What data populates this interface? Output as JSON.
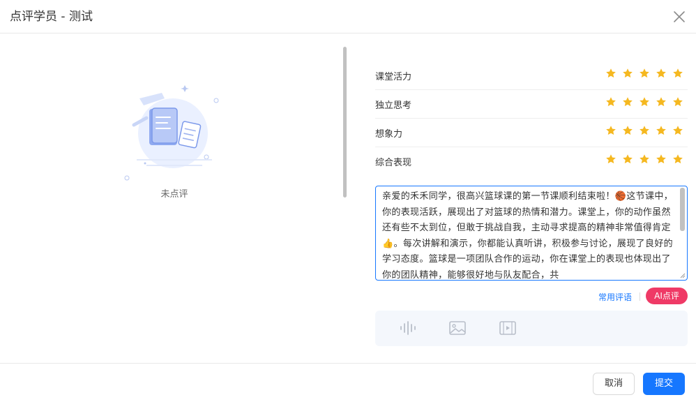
{
  "dialog": {
    "title": "点评学员 - 测试",
    "close_icon": "close-icon"
  },
  "left": {
    "empty_label": "未点评",
    "illustration_icon": "empty-document-illustration"
  },
  "ratings": {
    "max_stars": 5,
    "items": [
      {
        "label": "课堂活力",
        "score": 5
      },
      {
        "label": "独立思考",
        "score": 5
      },
      {
        "label": "想象力",
        "score": 5
      },
      {
        "label": "综合表现",
        "score": 5
      }
    ]
  },
  "comment": {
    "text": "亲爱的禾禾同学，很高兴篮球课的第一节课顺利结束啦！🏀这节课中，你的表现活跃，展现出了对篮球的热情和潜力。课堂上，你的动作虽然还有些不太到位，但敢于挑战自我，主动寻求提高的精神非常值得肯定👍。每次讲解和演示，你都能认真听讲，积极参与讨论，展现了良好的学习态度。篮球是一项团队合作的运动，你在课堂上的表现也体现出了你的团队精神，能够很好地与队友配合，共"
  },
  "actions": {
    "common_phrases": "常用评语",
    "ai_review": "AI点评"
  },
  "media": {
    "icons": [
      "audio-wave-icon",
      "image-icon",
      "video-icon"
    ]
  },
  "footer": {
    "cancel": "取消",
    "submit": "提交"
  },
  "colors": {
    "primary": "#1677ff",
    "star": "#f5b820",
    "ai_button": "#ef3a66"
  }
}
